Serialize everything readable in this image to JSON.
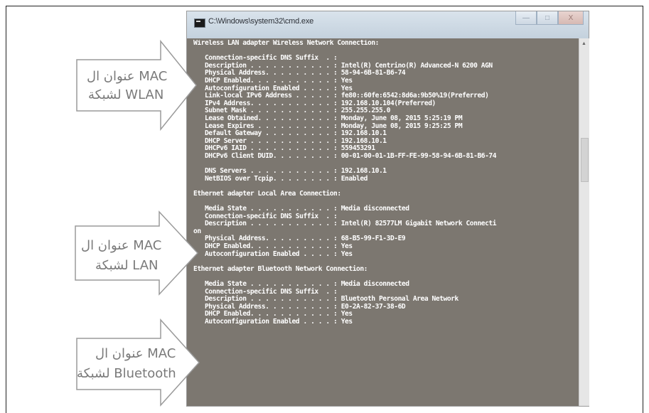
{
  "window": {
    "title": "C:\\Windows\\system32\\cmd.exe",
    "buttons": {
      "minimize": "—",
      "maximize": "□",
      "close": "X"
    }
  },
  "console_lines": [
    "Wireless LAN adapter Wireless Network Connection:",
    "",
    "   Connection-specific DNS Suffix  . :",
    "   Description . . . . . . . . . . . : Intel(R) Centrino(R) Advanced-N 6200 AGN",
    "   Physical Address. . . . . . . . . : 58-94-6B-81-B6-74",
    "   DHCP Enabled. . . . . . . . . . . : Yes",
    "   Autoconfiguration Enabled . . . . : Yes",
    "   Link-local IPv6 Address . . . . . : fe80::60fe:6542:8d6a:9b50%19(Preferred)",
    "   IPv4 Address. . . . . . . . . . . : 192.168.10.104(Preferred)",
    "   Subnet Mask . . . . . . . . . . . : 255.255.255.0",
    "   Lease Obtained. . . . . . . . . . : Monday, June 08, 2015 5:25:19 PM",
    "   Lease Expires . . . . . . . . . . : Monday, June 08, 2015 9:25:25 PM",
    "   Default Gateway . . . . . . . . . : 192.168.10.1",
    "   DHCP Server . . . . . . . . . . . : 192.168.10.1",
    "   DHCPv6 IAID . . . . . . . . . . . : 559453291",
    "   DHCPv6 Client DUID. . . . . . . . : 00-01-00-01-1B-FF-FE-99-58-94-6B-81-B6-74",
    "",
    "   DNS Servers . . . . . . . . . . . : 192.168.10.1",
    "   NetBIOS over Tcpip. . . . . . . . : Enabled",
    "",
    "Ethernet adapter Local Area Connection:",
    "",
    "   Media State . . . . . . . . . . . : Media disconnected",
    "   Connection-specific DNS Suffix  . :",
    "   Description . . . . . . . . . . . : Intel(R) 82577LM Gigabit Network Connecti",
    "on",
    "   Physical Address. . . . . . . . . : 68-B5-99-F1-3D-E9",
    "   DHCP Enabled. . . . . . . . . . . : Yes",
    "   Autoconfiguration Enabled . . . . : Yes",
    "",
    "Ethernet adapter Bluetooth Network Connection:",
    "",
    "   Media State . . . . . . . . . . . : Media disconnected",
    "   Connection-specific DNS Suffix  . :",
    "   Description . . . . . . . . . . . : Bluetooth Personal Area Network",
    "   Physical Address. . . . . . . . . : E0-2A-82-37-38-6D",
    "   DHCP Enabled. . . . . . . . . . . : Yes",
    "   Autoconfiguration Enabled . . . . : Yes"
  ],
  "callouts": [
    {
      "line1": "عنوان ال MAC",
      "line2": "لشبكة WLAN"
    },
    {
      "line1": "عنوان ال MAC",
      "line2": "لشبكة LAN"
    },
    {
      "line1": "عنوان ال MAC",
      "line2": "لشبكة Bluetooth"
    }
  ]
}
